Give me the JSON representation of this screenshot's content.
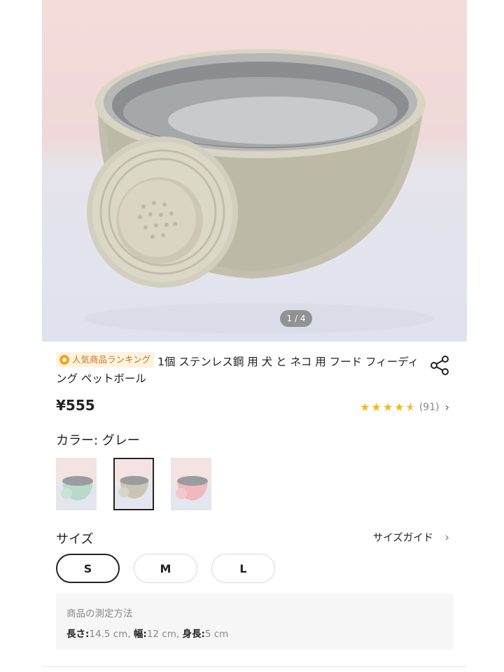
{
  "gallery": {
    "pager": "1 / 4"
  },
  "product": {
    "ranking_badge": "人気商品ランキング",
    "title": "1個 ステンレス鋼 用 犬 と ネコ 用 フード フィーディング ペットボール",
    "price": "¥555",
    "rating_value": 4.5,
    "review_count": "(91)"
  },
  "color": {
    "label": "カラー: グレー",
    "swatches": [
      {
        "name": "mint",
        "color": "#b9d9c9"
      },
      {
        "name": "gray",
        "color": "#c9c5b2"
      },
      {
        "name": "pink",
        "color": "#efb9bf"
      }
    ]
  },
  "size": {
    "label": "サイズ",
    "guide": "サイズガイド",
    "options": [
      "S",
      "M",
      "L"
    ],
    "selected": "S"
  },
  "measurement": {
    "title": "商品の測定方法",
    "length_label": "長さ:",
    "length_value": "14.5 cm,",
    "width_label": "幅:",
    "width_value": "12 cm,",
    "height_label": "身長:",
    "height_value": "5 cm"
  },
  "icons": {
    "share": "share-icon",
    "medal": "medal-icon",
    "chevron": "chevron-right-icon",
    "star": "star-icon"
  }
}
